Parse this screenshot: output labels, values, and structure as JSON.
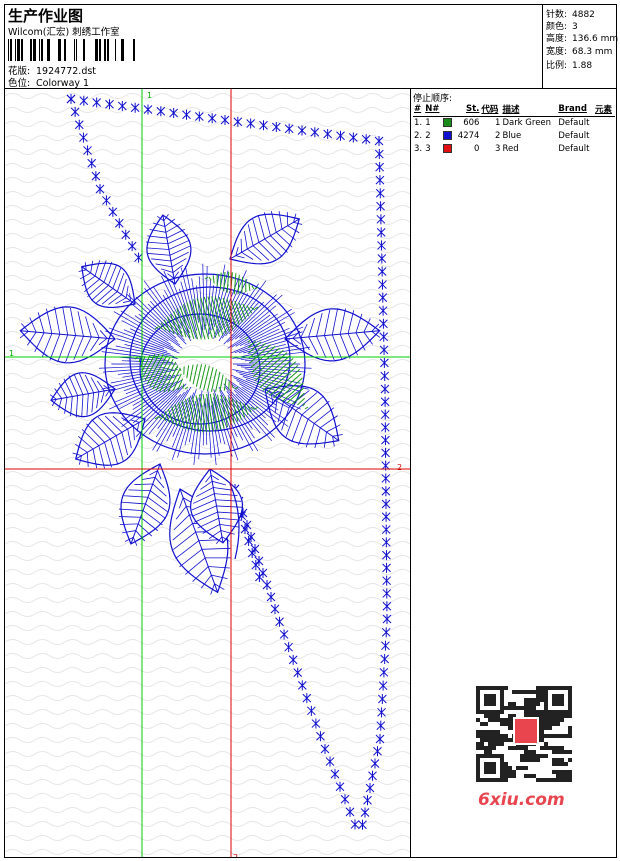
{
  "header": {
    "title": "生产作业图",
    "company": "Wilcom(汇宏) 刺绣工作室",
    "design_label": "花版:",
    "design_value": "1924772.dst",
    "colorway_label": "色位:",
    "colorway_value": "Colorway 1"
  },
  "stats": {
    "stitches_label": "针数:",
    "stitches_value": "4882",
    "colors_label": "颜色:",
    "colors_value": "3",
    "height_label": "高度:",
    "height_value": "136.6 mm",
    "width_label": "宽度:",
    "width_value": "68.3 mm",
    "scale_label": "比例:",
    "scale_value": "1.88"
  },
  "stop_sequence": {
    "title": "停止顺序:",
    "columns": [
      "#",
      "N#",
      "",
      "St.",
      "代码",
      "描述",
      "Brand",
      "元素"
    ],
    "rows": [
      {
        "num": "1.",
        "n": "1",
        "color": "#1a8a1a",
        "st": "606",
        "code": "1",
        "desc": "Dark Green",
        "brand": "Default"
      },
      {
        "num": "2.",
        "n": "2",
        "color": "#1010d0",
        "st": "4274",
        "code": "2",
        "desc": "Blue",
        "brand": "Default"
      },
      {
        "num": "3.",
        "n": "3",
        "color": "#e01010",
        "st": "0",
        "code": "3",
        "desc": "Red",
        "brand": "Default"
      }
    ]
  },
  "axes": {
    "green_top": "1",
    "green_left": "1",
    "red_right": "2",
    "red_bottom": "2"
  },
  "colors": {
    "thread_blue": "#1010d0",
    "thread_green": "#1a9a1a",
    "axis_green": "#00cc00",
    "axis_red": "#dd0000"
  },
  "watermark": {
    "text": "6xiu.com"
  }
}
